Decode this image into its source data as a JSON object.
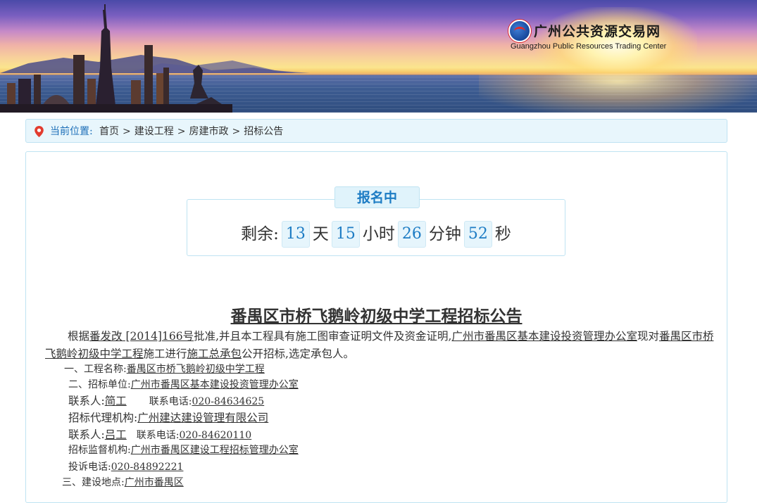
{
  "header": {
    "logo_cn": "广州公共资源交易网",
    "logo_en": "Guangzhou Public Resources Trading Center"
  },
  "breadcrumb": {
    "label": "当前位置:",
    "items": [
      "首页",
      "建设工程",
      "房建市政",
      "招标公告"
    ],
    "separator": ">"
  },
  "countdown": {
    "status": "报名中",
    "prefix": "剩余:",
    "days": "13",
    "days_unit": "天",
    "hours": "15",
    "hours_unit": "小时",
    "minutes": "26",
    "minutes_unit": "分钟",
    "seconds": "52",
    "seconds_unit": "秒"
  },
  "notice": {
    "title": "番禺区市桥飞鹅岭初级中学工程招标公告",
    "intro": {
      "p1": "根据",
      "approval_no": "番发改 [2014]166号",
      "p2": "批准,并且本工程具有施工图审查证明文件及资金证明,",
      "owner": "广州市番禺区基本建设投资管理办公室",
      "p3": "现对",
      "project": "番禺区市桥飞鹅岭初级中学工程",
      "p4": "施工进行",
      "contract": "施工总承包",
      "p5": "公开招标,选定承包人。"
    },
    "items": {
      "project_name_label": "一、工程名称:",
      "project_name": "番禺区市桥飞鹅岭初级中学工程",
      "tenderer_label": "二、招标单位:",
      "tenderer": "广州市番禺区基本建设投资管理办公室",
      "contact1_label": "联系人:",
      "contact1": "简工",
      "phone1_label": "联系电话:",
      "phone1": "020-84634625",
      "agency_label": "招标代理机构:",
      "agency": "广州建达建设管理有限公司",
      "contact2_label": "联系人:",
      "contact2": "吕工",
      "phone2_label": "联系电话:",
      "phone2": "020-84620110",
      "supervisor_label": "招标监督机构:",
      "supervisor": "广州市番禺区建设工程招标管理办公室",
      "complaint_label": "投诉电话:",
      "complaint": "020-84892221",
      "location_label": "三、建设地点:",
      "location": "广州市番禺区"
    }
  }
}
